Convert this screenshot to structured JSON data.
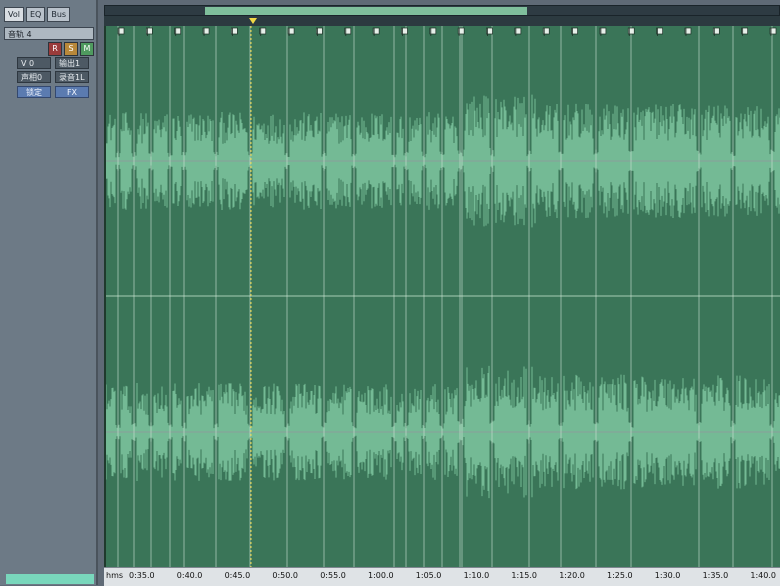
{
  "left_panel": {
    "tabs": [
      "Vol",
      "EQ",
      "Bus"
    ],
    "active_tab": "Vol",
    "track_name": "音轨 4",
    "rsm": [
      "R",
      "S",
      "M"
    ],
    "volume_field": "V 0",
    "output_button": "输出1",
    "pan_field": "声相0",
    "input_button": "录音1L",
    "lock_button": "锁定",
    "fx_button": "FX"
  },
  "timeline": {
    "unit_label": "hms",
    "ticks": [
      "0:35.0",
      "0:40.0",
      "0:45.0",
      "0:50.0",
      "0:55.0",
      "1:00.0",
      "1:05.0",
      "1:10.0",
      "1:15.0",
      "1:20.0",
      "1:25.0",
      "1:30.0",
      "1:35.0",
      "1:40.0"
    ]
  },
  "markers": {
    "icon": "marker-flag-icon",
    "count": 24
  },
  "colors": {
    "wave_bg": "#3a7558",
    "wave_fill": "#7fc7a0",
    "status_cyan": "#79d7bc"
  }
}
